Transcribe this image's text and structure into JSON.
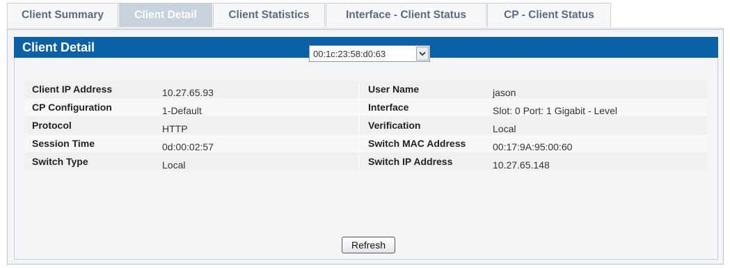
{
  "tabs": [
    {
      "label": "Client Summary"
    },
    {
      "label": "Client Detail"
    },
    {
      "label": "Client Statistics"
    },
    {
      "label": "Interface - Client Status"
    },
    {
      "label": "CP - Client Status"
    }
  ],
  "active_tab": "Client Detail",
  "panel": {
    "title": "Client Detail"
  },
  "mac_select": {
    "value": "00:1c:23:58:d0:63"
  },
  "details": {
    "left": [
      {
        "label": "Client IP Address",
        "value": "10.27.65.93"
      },
      {
        "label": "CP Configuration",
        "value": "1-Default"
      },
      {
        "label": "Protocol",
        "value": "HTTP"
      },
      {
        "label": "Session Time",
        "value": "0d:00:02:57"
      },
      {
        "label": "Switch Type",
        "value": "Local"
      }
    ],
    "right": [
      {
        "label": "User Name",
        "value": "jason"
      },
      {
        "label": "Interface",
        "value": "Slot: 0 Port: 1 Gigabit - Level"
      },
      {
        "label": "Verification",
        "value": "Local"
      },
      {
        "label": "Switch MAC Address",
        "value": "00:17:9A:95:00:60"
      },
      {
        "label": "Switch IP Address",
        "value": "10.27.65.148"
      }
    ]
  },
  "refresh_label": "Refresh"
}
